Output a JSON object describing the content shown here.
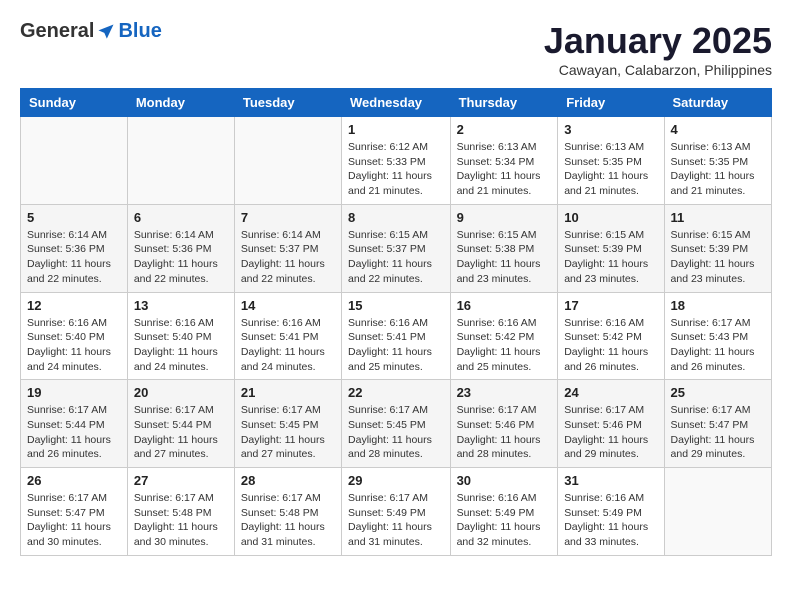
{
  "logo": {
    "general": "General",
    "blue": "Blue"
  },
  "title": "January 2025",
  "location": "Cawayan, Calabarzon, Philippines",
  "weekdays": [
    "Sunday",
    "Monday",
    "Tuesday",
    "Wednesday",
    "Thursday",
    "Friday",
    "Saturday"
  ],
  "weeks": [
    [
      {
        "day": "",
        "info": ""
      },
      {
        "day": "",
        "info": ""
      },
      {
        "day": "",
        "info": ""
      },
      {
        "day": "1",
        "info": "Sunrise: 6:12 AM\nSunset: 5:33 PM\nDaylight: 11 hours\nand 21 minutes."
      },
      {
        "day": "2",
        "info": "Sunrise: 6:13 AM\nSunset: 5:34 PM\nDaylight: 11 hours\nand 21 minutes."
      },
      {
        "day": "3",
        "info": "Sunrise: 6:13 AM\nSunset: 5:35 PM\nDaylight: 11 hours\nand 21 minutes."
      },
      {
        "day": "4",
        "info": "Sunrise: 6:13 AM\nSunset: 5:35 PM\nDaylight: 11 hours\nand 21 minutes."
      }
    ],
    [
      {
        "day": "5",
        "info": "Sunrise: 6:14 AM\nSunset: 5:36 PM\nDaylight: 11 hours\nand 22 minutes."
      },
      {
        "day": "6",
        "info": "Sunrise: 6:14 AM\nSunset: 5:36 PM\nDaylight: 11 hours\nand 22 minutes."
      },
      {
        "day": "7",
        "info": "Sunrise: 6:14 AM\nSunset: 5:37 PM\nDaylight: 11 hours\nand 22 minutes."
      },
      {
        "day": "8",
        "info": "Sunrise: 6:15 AM\nSunset: 5:37 PM\nDaylight: 11 hours\nand 22 minutes."
      },
      {
        "day": "9",
        "info": "Sunrise: 6:15 AM\nSunset: 5:38 PM\nDaylight: 11 hours\nand 23 minutes."
      },
      {
        "day": "10",
        "info": "Sunrise: 6:15 AM\nSunset: 5:39 PM\nDaylight: 11 hours\nand 23 minutes."
      },
      {
        "day": "11",
        "info": "Sunrise: 6:15 AM\nSunset: 5:39 PM\nDaylight: 11 hours\nand 23 minutes."
      }
    ],
    [
      {
        "day": "12",
        "info": "Sunrise: 6:16 AM\nSunset: 5:40 PM\nDaylight: 11 hours\nand 24 minutes."
      },
      {
        "day": "13",
        "info": "Sunrise: 6:16 AM\nSunset: 5:40 PM\nDaylight: 11 hours\nand 24 minutes."
      },
      {
        "day": "14",
        "info": "Sunrise: 6:16 AM\nSunset: 5:41 PM\nDaylight: 11 hours\nand 24 minutes."
      },
      {
        "day": "15",
        "info": "Sunrise: 6:16 AM\nSunset: 5:41 PM\nDaylight: 11 hours\nand 25 minutes."
      },
      {
        "day": "16",
        "info": "Sunrise: 6:16 AM\nSunset: 5:42 PM\nDaylight: 11 hours\nand 25 minutes."
      },
      {
        "day": "17",
        "info": "Sunrise: 6:16 AM\nSunset: 5:42 PM\nDaylight: 11 hours\nand 26 minutes."
      },
      {
        "day": "18",
        "info": "Sunrise: 6:17 AM\nSunset: 5:43 PM\nDaylight: 11 hours\nand 26 minutes."
      }
    ],
    [
      {
        "day": "19",
        "info": "Sunrise: 6:17 AM\nSunset: 5:44 PM\nDaylight: 11 hours\nand 26 minutes."
      },
      {
        "day": "20",
        "info": "Sunrise: 6:17 AM\nSunset: 5:44 PM\nDaylight: 11 hours\nand 27 minutes."
      },
      {
        "day": "21",
        "info": "Sunrise: 6:17 AM\nSunset: 5:45 PM\nDaylight: 11 hours\nand 27 minutes."
      },
      {
        "day": "22",
        "info": "Sunrise: 6:17 AM\nSunset: 5:45 PM\nDaylight: 11 hours\nand 28 minutes."
      },
      {
        "day": "23",
        "info": "Sunrise: 6:17 AM\nSunset: 5:46 PM\nDaylight: 11 hours\nand 28 minutes."
      },
      {
        "day": "24",
        "info": "Sunrise: 6:17 AM\nSunset: 5:46 PM\nDaylight: 11 hours\nand 29 minutes."
      },
      {
        "day": "25",
        "info": "Sunrise: 6:17 AM\nSunset: 5:47 PM\nDaylight: 11 hours\nand 29 minutes."
      }
    ],
    [
      {
        "day": "26",
        "info": "Sunrise: 6:17 AM\nSunset: 5:47 PM\nDaylight: 11 hours\nand 30 minutes."
      },
      {
        "day": "27",
        "info": "Sunrise: 6:17 AM\nSunset: 5:48 PM\nDaylight: 11 hours\nand 30 minutes."
      },
      {
        "day": "28",
        "info": "Sunrise: 6:17 AM\nSunset: 5:48 PM\nDaylight: 11 hours\nand 31 minutes."
      },
      {
        "day": "29",
        "info": "Sunrise: 6:17 AM\nSunset: 5:49 PM\nDaylight: 11 hours\nand 31 minutes."
      },
      {
        "day": "30",
        "info": "Sunrise: 6:16 AM\nSunset: 5:49 PM\nDaylight: 11 hours\nand 32 minutes."
      },
      {
        "day": "31",
        "info": "Sunrise: 6:16 AM\nSunset: 5:49 PM\nDaylight: 11 hours\nand 33 minutes."
      },
      {
        "day": "",
        "info": ""
      }
    ]
  ]
}
